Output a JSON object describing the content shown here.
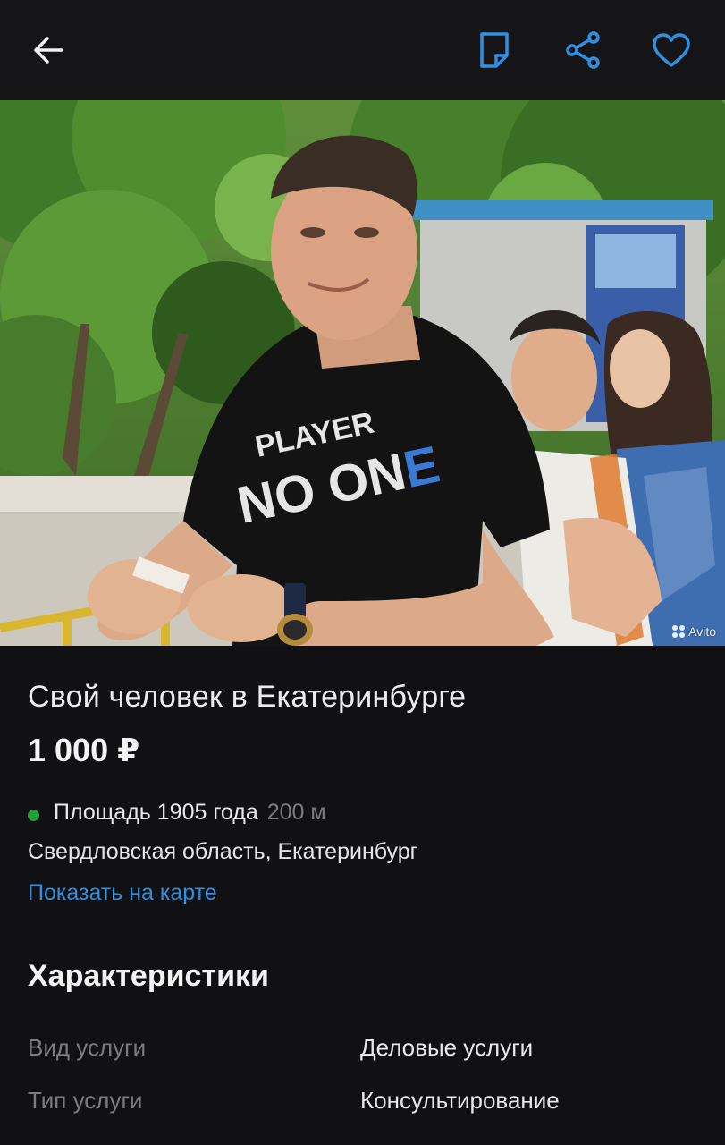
{
  "toolbar": {
    "back_icon": "arrow-left-icon",
    "note_icon": "note-icon",
    "share_icon": "share-icon",
    "favorite_icon": "heart-icon",
    "accent_color": "#2f8fe0"
  },
  "photo": {
    "shirt_text_line1": "PLAYER",
    "shirt_text_line2": "NO ON",
    "shirt_text_accent": "E",
    "watermark": "Avito"
  },
  "listing": {
    "title": "Свой человек в Екатеринбурге",
    "price": "1 000 ₽",
    "metro_name": "Площадь 1905 года",
    "metro_distance": "200 м",
    "metro_color": "#21a038",
    "region": "Свердловская область, Екатеринбург",
    "map_link": "Показать на карте"
  },
  "characteristics": {
    "title": "Характеристики",
    "rows": [
      {
        "key": "Вид услуги",
        "value": "Деловые услуги"
      },
      {
        "key": "Тип услуги",
        "value": "Консультирование"
      }
    ]
  }
}
